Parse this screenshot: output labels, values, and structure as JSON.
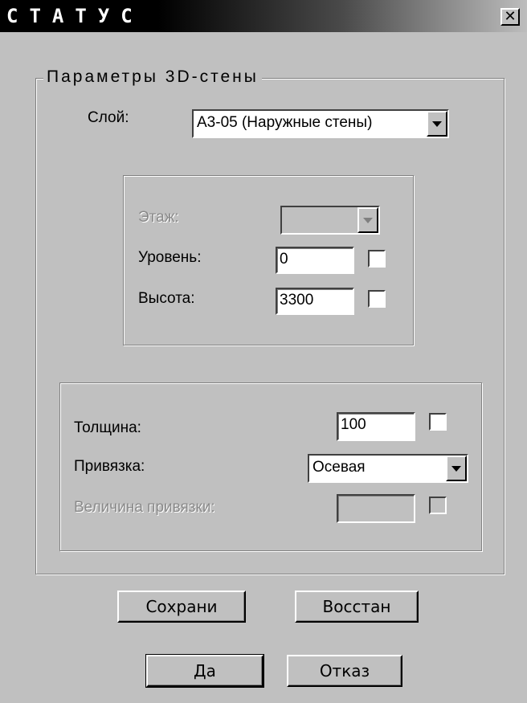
{
  "window": {
    "title": "СТАТУС",
    "close_glyph": "✕"
  },
  "group": {
    "legend": "Параметры 3D-стены"
  },
  "layer": {
    "label": "Слой:",
    "value": "A3-05 (Наружные стены)"
  },
  "floor_panel": {
    "floor_label": "Этаж:",
    "floor_value": "",
    "level_label": "Уровень:",
    "level_value": "0",
    "height_label": "Высота:",
    "height_value": "3300"
  },
  "wall_panel": {
    "thickness_label": "Толщина:",
    "thickness_value": "100",
    "anchor_label": "Привязка:",
    "anchor_value": "Осевая",
    "anchor_size_label": "Величина привязки:",
    "anchor_size_value": ""
  },
  "buttons": {
    "save": "Сохрани",
    "restore": "Восстан",
    "ok": "Да",
    "cancel": "Отказ"
  },
  "icons": {
    "close": "close-icon",
    "dropdown": "chevron-down-icon"
  }
}
